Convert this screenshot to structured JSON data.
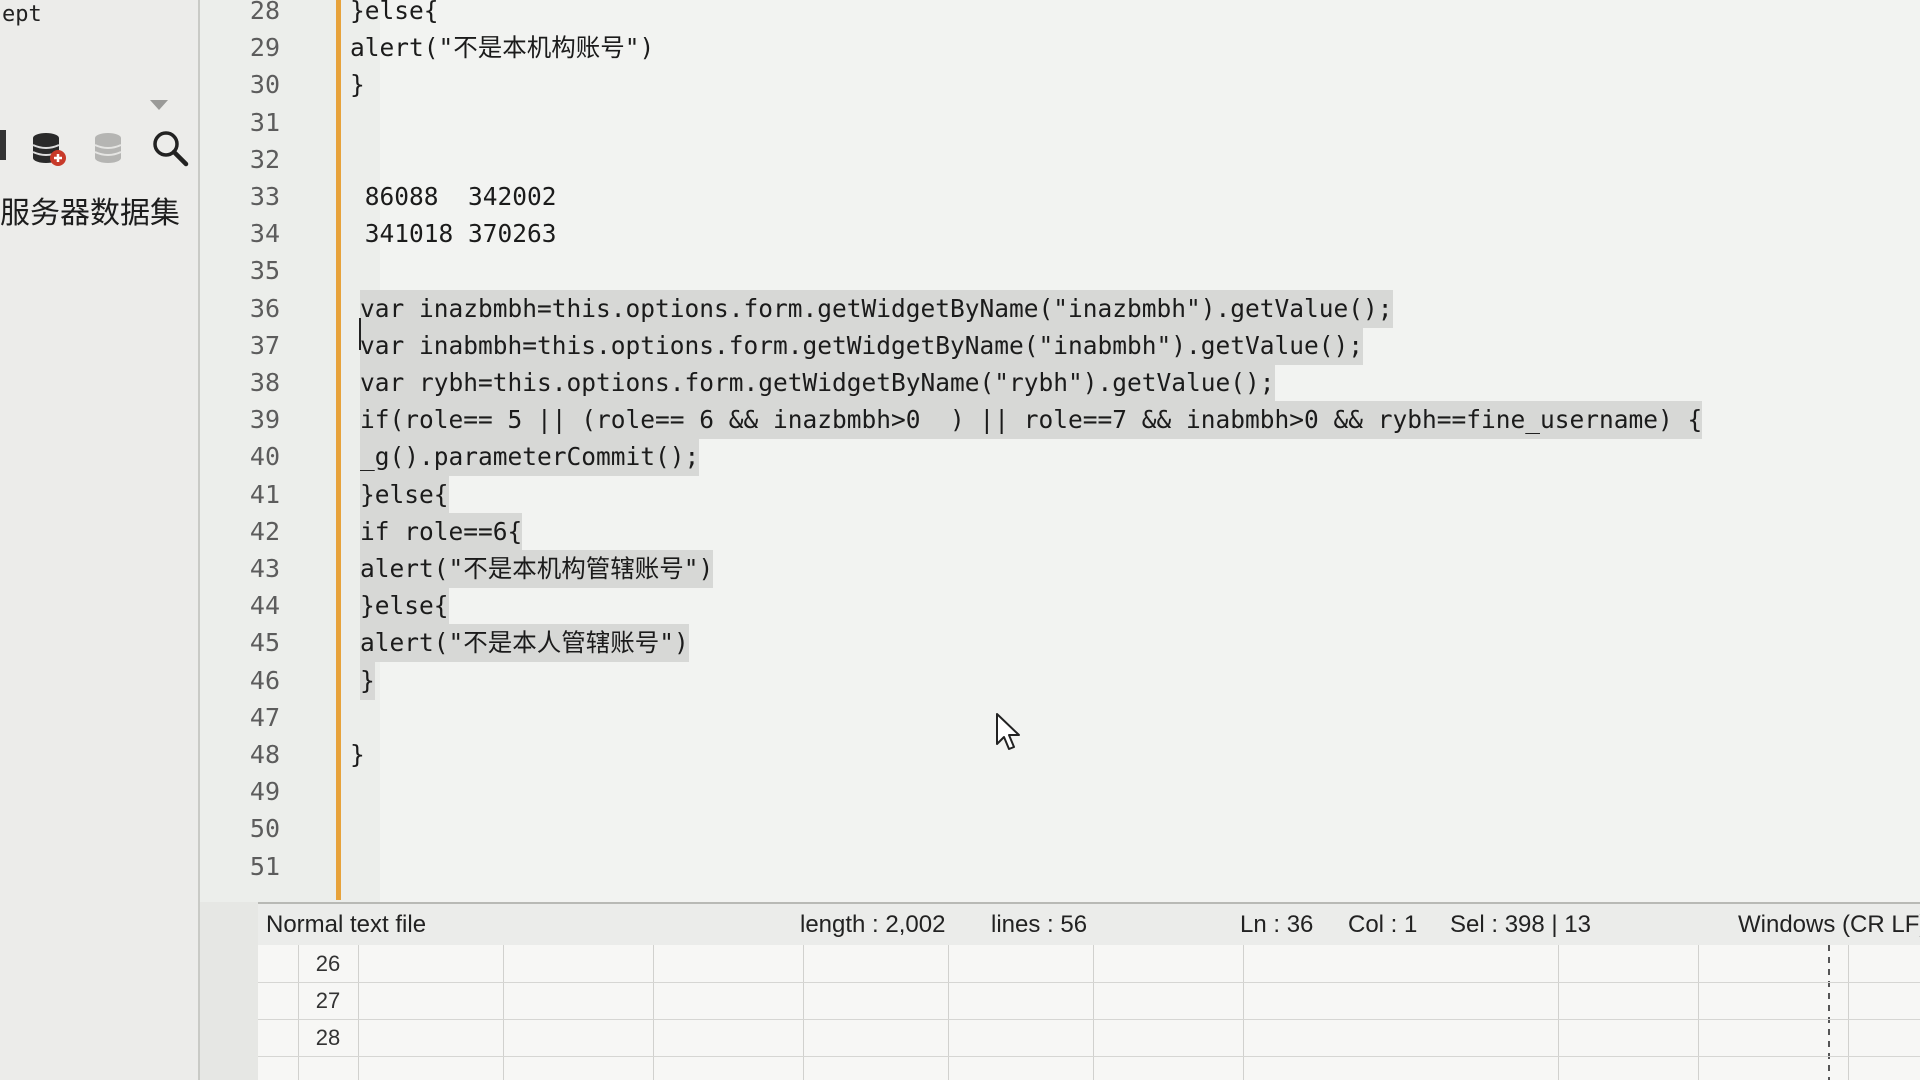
{
  "sidebar": {
    "top_text": "ept",
    "label": "服务器数据集",
    "icons": [
      "database-add-icon",
      "database-disabled-icon",
      "search-icon"
    ]
  },
  "editor": {
    "lines": [
      {
        "num": "28",
        "text": "}else{",
        "selected": false
      },
      {
        "num": "29",
        "text": "alert(\"不是本机构账号\")",
        "selected": false
      },
      {
        "num": "30",
        "text": "}",
        "selected": false
      },
      {
        "num": "31",
        "text": "",
        "selected": false
      },
      {
        "num": "32",
        "text": "",
        "selected": false
      },
      {
        "num": "33",
        "text": " 86088  342002",
        "selected": false
      },
      {
        "num": "34",
        "text": " 341018 370263",
        "selected": false
      },
      {
        "num": "35",
        "text": "",
        "selected": false
      },
      {
        "num": "36",
        "text": "var inazbmbh=this.options.form.getWidgetByName(\"inazbmbh\").getValue();",
        "selected": true
      },
      {
        "num": "37",
        "text": "var inabmbh=this.options.form.getWidgetByName(\"inabmbh\").getValue();",
        "selected": true
      },
      {
        "num": "38",
        "text": "var rybh=this.options.form.getWidgetByName(\"rybh\").getValue();",
        "selected": true
      },
      {
        "num": "39",
        "text": "if(role== 5 || (role== 6 && inazbmbh>0  ) || role==7 && inabmbh>0 && rybh==fine_username) {",
        "selected": true
      },
      {
        "num": "40",
        "text": "_g().parameterCommit();",
        "selected": true
      },
      {
        "num": "41",
        "text": "}else{",
        "selected": true
      },
      {
        "num": "42",
        "text": "if role==6{",
        "selected": true
      },
      {
        "num": "43",
        "text": "alert(\"不是本机构管辖账号\")",
        "selected": true
      },
      {
        "num": "44",
        "text": "}else{",
        "selected": true
      },
      {
        "num": "45",
        "text": "alert(\"不是本人管辖账号\")",
        "selected": true
      },
      {
        "num": "46",
        "text": "}",
        "selected": true
      },
      {
        "num": "47",
        "text": "",
        "selected": false
      },
      {
        "num": "48",
        "text": "}",
        "selected": false
      },
      {
        "num": "49",
        "text": "",
        "selected": false
      },
      {
        "num": "50",
        "text": "",
        "selected": false
      },
      {
        "num": "51",
        "text": "",
        "selected": false
      }
    ]
  },
  "statusbar": {
    "file_type": "Normal text file",
    "length": "length : 2,002",
    "lines": "lines : 56",
    "ln": "Ln : 36",
    "col": "Col : 1",
    "sel": "Sel : 398 | 13",
    "eol": "Windows (CR LF)"
  },
  "sheet": {
    "rows": [
      "26",
      "27",
      "28"
    ]
  },
  "colors": {
    "fold_bar": "#e7a23a",
    "selection": "#d7d8d6",
    "editor_bg": "#f2f3f1"
  }
}
